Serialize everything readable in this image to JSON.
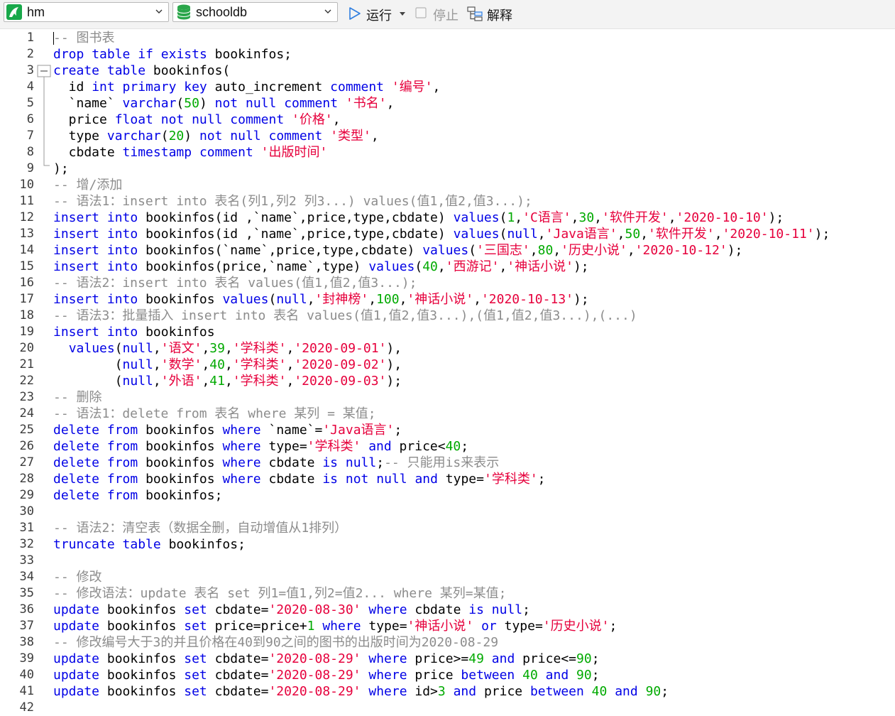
{
  "toolbar": {
    "connection": "hm",
    "database": "schooldb",
    "run_label": "运行",
    "stop_label": "停止",
    "explain_label": "解释",
    "colors": {
      "accent": "#2f7ee0",
      "connection_icon": "#18a84a",
      "db_icon": "#2aa64a"
    }
  },
  "editor": {
    "colors": {
      "keyword": "#0000e6",
      "string": "#e6003c",
      "number": "#00aa00",
      "comment": "#8c8c8c"
    },
    "lines": [
      [
        [
          "c",
          "-- 图书表"
        ]
      ],
      [
        [
          "k",
          "drop"
        ],
        [
          "t",
          " "
        ],
        [
          "k",
          "table"
        ],
        [
          "t",
          " "
        ],
        [
          "k",
          "if"
        ],
        [
          "t",
          " "
        ],
        [
          "k",
          "exists"
        ],
        [
          "t",
          " bookinfos;"
        ]
      ],
      [
        [
          "k",
          "create"
        ],
        [
          "t",
          " "
        ],
        [
          "k",
          "table"
        ],
        [
          "t",
          " bookinfos("
        ]
      ],
      [
        [
          "t",
          "  id "
        ],
        [
          "k",
          "int"
        ],
        [
          "t",
          " "
        ],
        [
          "k",
          "primary"
        ],
        [
          "t",
          " "
        ],
        [
          "k",
          "key"
        ],
        [
          "t",
          " auto_increment "
        ],
        [
          "k",
          "comment"
        ],
        [
          "t",
          " "
        ],
        [
          "s",
          "'编号'"
        ],
        [
          "t",
          ","
        ]
      ],
      [
        [
          "t",
          "  `name` "
        ],
        [
          "k",
          "varchar"
        ],
        [
          "t",
          "("
        ],
        [
          "n",
          "50"
        ],
        [
          "t",
          ") "
        ],
        [
          "k",
          "not"
        ],
        [
          "t",
          " "
        ],
        [
          "k",
          "null"
        ],
        [
          "t",
          " "
        ],
        [
          "k",
          "comment"
        ],
        [
          "t",
          " "
        ],
        [
          "s",
          "'书名'"
        ],
        [
          "t",
          ","
        ]
      ],
      [
        [
          "t",
          "  price "
        ],
        [
          "k",
          "float"
        ],
        [
          "t",
          " "
        ],
        [
          "k",
          "not"
        ],
        [
          "t",
          " "
        ],
        [
          "k",
          "null"
        ],
        [
          "t",
          " "
        ],
        [
          "k",
          "comment"
        ],
        [
          "t",
          " "
        ],
        [
          "s",
          "'价格'"
        ],
        [
          "t",
          ","
        ]
      ],
      [
        [
          "t",
          "  type "
        ],
        [
          "k",
          "varchar"
        ],
        [
          "t",
          "("
        ],
        [
          "n",
          "20"
        ],
        [
          "t",
          ") "
        ],
        [
          "k",
          "not"
        ],
        [
          "t",
          " "
        ],
        [
          "k",
          "null"
        ],
        [
          "t",
          " "
        ],
        [
          "k",
          "comment"
        ],
        [
          "t",
          " "
        ],
        [
          "s",
          "'类型'"
        ],
        [
          "t",
          ","
        ]
      ],
      [
        [
          "t",
          "  cbdate "
        ],
        [
          "k",
          "timestamp"
        ],
        [
          "t",
          " "
        ],
        [
          "k",
          "comment"
        ],
        [
          "t",
          " "
        ],
        [
          "s",
          "'出版时间'"
        ]
      ],
      [
        [
          "t",
          ");"
        ]
      ],
      [
        [
          "c",
          "-- 增/添加"
        ]
      ],
      [
        [
          "c",
          "-- 语法1：insert into 表名(列1,列2 列3...) values(值1,值2,值3...);"
        ]
      ],
      [
        [
          "k",
          "insert"
        ],
        [
          "t",
          " "
        ],
        [
          "k",
          "into"
        ],
        [
          "t",
          " bookinfos(id ,`name`,price,type,cbdate) "
        ],
        [
          "k",
          "values"
        ],
        [
          "t",
          "("
        ],
        [
          "n",
          "1"
        ],
        [
          "t",
          ","
        ],
        [
          "s",
          "'C语言'"
        ],
        [
          "t",
          ","
        ],
        [
          "n",
          "30"
        ],
        [
          "t",
          ","
        ],
        [
          "s",
          "'软件开发'"
        ],
        [
          "t",
          ","
        ],
        [
          "s",
          "'2020-10-10'"
        ],
        [
          "t",
          ");"
        ]
      ],
      [
        [
          "k",
          "insert"
        ],
        [
          "t",
          " "
        ],
        [
          "k",
          "into"
        ],
        [
          "t",
          " bookinfos(id ,`name`,price,type,cbdate) "
        ],
        [
          "k",
          "values"
        ],
        [
          "t",
          "("
        ],
        [
          "k",
          "null"
        ],
        [
          "t",
          ","
        ],
        [
          "s",
          "'Java语言'"
        ],
        [
          "t",
          ","
        ],
        [
          "n",
          "50"
        ],
        [
          "t",
          ","
        ],
        [
          "s",
          "'软件开发'"
        ],
        [
          "t",
          ","
        ],
        [
          "s",
          "'2020-10-11'"
        ],
        [
          "t",
          ");"
        ]
      ],
      [
        [
          "k",
          "insert"
        ],
        [
          "t",
          " "
        ],
        [
          "k",
          "into"
        ],
        [
          "t",
          " bookinfos(`name`,price,type,cbdate) "
        ],
        [
          "k",
          "values"
        ],
        [
          "t",
          "("
        ],
        [
          "s",
          "'三国志'"
        ],
        [
          "t",
          ","
        ],
        [
          "n",
          "80"
        ],
        [
          "t",
          ","
        ],
        [
          "s",
          "'历史小说'"
        ],
        [
          "t",
          ","
        ],
        [
          "s",
          "'2020-10-12'"
        ],
        [
          "t",
          ");"
        ]
      ],
      [
        [
          "k",
          "insert"
        ],
        [
          "t",
          " "
        ],
        [
          "k",
          "into"
        ],
        [
          "t",
          " bookinfos(price,`name`,type) "
        ],
        [
          "k",
          "values"
        ],
        [
          "t",
          "("
        ],
        [
          "n",
          "40"
        ],
        [
          "t",
          ","
        ],
        [
          "s",
          "'西游记'"
        ],
        [
          "t",
          ","
        ],
        [
          "s",
          "'神话小说'"
        ],
        [
          "t",
          ");"
        ]
      ],
      [
        [
          "c",
          "-- 语法2：insert into 表名 values(值1,值2,值3...);"
        ]
      ],
      [
        [
          "k",
          "insert"
        ],
        [
          "t",
          " "
        ],
        [
          "k",
          "into"
        ],
        [
          "t",
          " bookinfos "
        ],
        [
          "k",
          "values"
        ],
        [
          "t",
          "("
        ],
        [
          "k",
          "null"
        ],
        [
          "t",
          ","
        ],
        [
          "s",
          "'封神榜'"
        ],
        [
          "t",
          ","
        ],
        [
          "n",
          "100"
        ],
        [
          "t",
          ","
        ],
        [
          "s",
          "'神话小说'"
        ],
        [
          "t",
          ","
        ],
        [
          "s",
          "'2020-10-13'"
        ],
        [
          "t",
          ");"
        ]
      ],
      [
        [
          "c",
          "-- 语法3：批量插入 insert into 表名 values(值1,值2,值3...),(值1,值2,值3...),(...)"
        ]
      ],
      [
        [
          "k",
          "insert"
        ],
        [
          "t",
          " "
        ],
        [
          "k",
          "into"
        ],
        [
          "t",
          " bookinfos"
        ]
      ],
      [
        [
          "t",
          "  "
        ],
        [
          "k",
          "values"
        ],
        [
          "t",
          "("
        ],
        [
          "k",
          "null"
        ],
        [
          "t",
          ","
        ],
        [
          "s",
          "'语文'"
        ],
        [
          "t",
          ","
        ],
        [
          "n",
          "39"
        ],
        [
          "t",
          ","
        ],
        [
          "s",
          "'学科类'"
        ],
        [
          "t",
          ","
        ],
        [
          "s",
          "'2020-09-01'"
        ],
        [
          "t",
          "),"
        ]
      ],
      [
        [
          "t",
          "        ("
        ],
        [
          "k",
          "null"
        ],
        [
          "t",
          ","
        ],
        [
          "s",
          "'数学'"
        ],
        [
          "t",
          ","
        ],
        [
          "n",
          "40"
        ],
        [
          "t",
          ","
        ],
        [
          "s",
          "'学科类'"
        ],
        [
          "t",
          ","
        ],
        [
          "s",
          "'2020-09-02'"
        ],
        [
          "t",
          "),"
        ]
      ],
      [
        [
          "t",
          "        ("
        ],
        [
          "k",
          "null"
        ],
        [
          "t",
          ","
        ],
        [
          "s",
          "'外语'"
        ],
        [
          "t",
          ","
        ],
        [
          "n",
          "41"
        ],
        [
          "t",
          ","
        ],
        [
          "s",
          "'学科类'"
        ],
        [
          "t",
          ","
        ],
        [
          "s",
          "'2020-09-03'"
        ],
        [
          "t",
          ");"
        ]
      ],
      [
        [
          "c",
          "-- 删除"
        ]
      ],
      [
        [
          "c",
          "-- 语法1：delete from 表名 where 某列 = 某值;"
        ]
      ],
      [
        [
          "k",
          "delete"
        ],
        [
          "t",
          " "
        ],
        [
          "k",
          "from"
        ],
        [
          "t",
          " bookinfos "
        ],
        [
          "k",
          "where"
        ],
        [
          "t",
          " `name`="
        ],
        [
          "s",
          "'Java语言'"
        ],
        [
          "t",
          ";"
        ]
      ],
      [
        [
          "k",
          "delete"
        ],
        [
          "t",
          " "
        ],
        [
          "k",
          "from"
        ],
        [
          "t",
          " bookinfos "
        ],
        [
          "k",
          "where"
        ],
        [
          "t",
          " type="
        ],
        [
          "s",
          "'学科类'"
        ],
        [
          "t",
          " "
        ],
        [
          "k",
          "and"
        ],
        [
          "t",
          " price<"
        ],
        [
          "n",
          "40"
        ],
        [
          "t",
          ";"
        ]
      ],
      [
        [
          "k",
          "delete"
        ],
        [
          "t",
          " "
        ],
        [
          "k",
          "from"
        ],
        [
          "t",
          " bookinfos "
        ],
        [
          "k",
          "where"
        ],
        [
          "t",
          " cbdate "
        ],
        [
          "k",
          "is"
        ],
        [
          "t",
          " "
        ],
        [
          "k",
          "null"
        ],
        [
          "t",
          ";"
        ],
        [
          "c",
          "-- 只能用is来表示"
        ]
      ],
      [
        [
          "k",
          "delete"
        ],
        [
          "t",
          " "
        ],
        [
          "k",
          "from"
        ],
        [
          "t",
          " bookinfos "
        ],
        [
          "k",
          "where"
        ],
        [
          "t",
          " cbdate "
        ],
        [
          "k",
          "is"
        ],
        [
          "t",
          " "
        ],
        [
          "k",
          "not"
        ],
        [
          "t",
          " "
        ],
        [
          "k",
          "null"
        ],
        [
          "t",
          " "
        ],
        [
          "k",
          "and"
        ],
        [
          "t",
          " type="
        ],
        [
          "s",
          "'学科类'"
        ],
        [
          "t",
          ";"
        ]
      ],
      [
        [
          "k",
          "delete"
        ],
        [
          "t",
          " "
        ],
        [
          "k",
          "from"
        ],
        [
          "t",
          " bookinfos;"
        ]
      ],
      [],
      [
        [
          "c",
          "-- 语法2：清空表（数据全删，自动增值从1排列）"
        ]
      ],
      [
        [
          "k",
          "truncate"
        ],
        [
          "t",
          " "
        ],
        [
          "k",
          "table"
        ],
        [
          "t",
          " bookinfos;"
        ]
      ],
      [],
      [
        [
          "c",
          "-- 修改"
        ]
      ],
      [
        [
          "c",
          "-- 修改语法：update 表名 set 列1=值1,列2=值2... where 某列=某值;"
        ]
      ],
      [
        [
          "k",
          "update"
        ],
        [
          "t",
          " bookinfos "
        ],
        [
          "k",
          "set"
        ],
        [
          "t",
          " cbdate="
        ],
        [
          "s",
          "'2020-08-30'"
        ],
        [
          "t",
          " "
        ],
        [
          "k",
          "where"
        ],
        [
          "t",
          " cbdate "
        ],
        [
          "k",
          "is"
        ],
        [
          "t",
          " "
        ],
        [
          "k",
          "null"
        ],
        [
          "t",
          ";"
        ]
      ],
      [
        [
          "k",
          "update"
        ],
        [
          "t",
          " bookinfos "
        ],
        [
          "k",
          "set"
        ],
        [
          "t",
          " price=price+"
        ],
        [
          "n",
          "1"
        ],
        [
          "t",
          " "
        ],
        [
          "k",
          "where"
        ],
        [
          "t",
          " type="
        ],
        [
          "s",
          "'神话小说'"
        ],
        [
          "t",
          " "
        ],
        [
          "k",
          "or"
        ],
        [
          "t",
          " type="
        ],
        [
          "s",
          "'历史小说'"
        ],
        [
          "t",
          ";"
        ]
      ],
      [
        [
          "c",
          "-- 修改编号大于3的并且价格在40到90之间的图书的出版时间为2020-08-29"
        ]
      ],
      [
        [
          "k",
          "update"
        ],
        [
          "t",
          " bookinfos "
        ],
        [
          "k",
          "set"
        ],
        [
          "t",
          " cbdate="
        ],
        [
          "s",
          "'2020-08-29'"
        ],
        [
          "t",
          " "
        ],
        [
          "k",
          "where"
        ],
        [
          "t",
          " price>="
        ],
        [
          "n",
          "49"
        ],
        [
          "t",
          " "
        ],
        [
          "k",
          "and"
        ],
        [
          "t",
          " price<="
        ],
        [
          "n",
          "90"
        ],
        [
          "t",
          ";"
        ]
      ],
      [
        [
          "k",
          "update"
        ],
        [
          "t",
          " bookinfos "
        ],
        [
          "k",
          "set"
        ],
        [
          "t",
          " cbdate="
        ],
        [
          "s",
          "'2020-08-29'"
        ],
        [
          "t",
          " "
        ],
        [
          "k",
          "where"
        ],
        [
          "t",
          " price "
        ],
        [
          "k",
          "between"
        ],
        [
          "t",
          " "
        ],
        [
          "n",
          "40"
        ],
        [
          "t",
          " "
        ],
        [
          "k",
          "and"
        ],
        [
          "t",
          " "
        ],
        [
          "n",
          "90"
        ],
        [
          "t",
          ";"
        ]
      ],
      [
        [
          "k",
          "update"
        ],
        [
          "t",
          " bookinfos "
        ],
        [
          "k",
          "set"
        ],
        [
          "t",
          " cbdate="
        ],
        [
          "s",
          "'2020-08-29'"
        ],
        [
          "t",
          " "
        ],
        [
          "k",
          "where"
        ],
        [
          "t",
          " id>"
        ],
        [
          "n",
          "3"
        ],
        [
          "t",
          " "
        ],
        [
          "k",
          "and"
        ],
        [
          "t",
          " price "
        ],
        [
          "k",
          "between"
        ],
        [
          "t",
          " "
        ],
        [
          "n",
          "40"
        ],
        [
          "t",
          " "
        ],
        [
          "k",
          "and"
        ],
        [
          "t",
          " "
        ],
        [
          "n",
          "90"
        ],
        [
          "t",
          ";"
        ]
      ],
      []
    ]
  }
}
